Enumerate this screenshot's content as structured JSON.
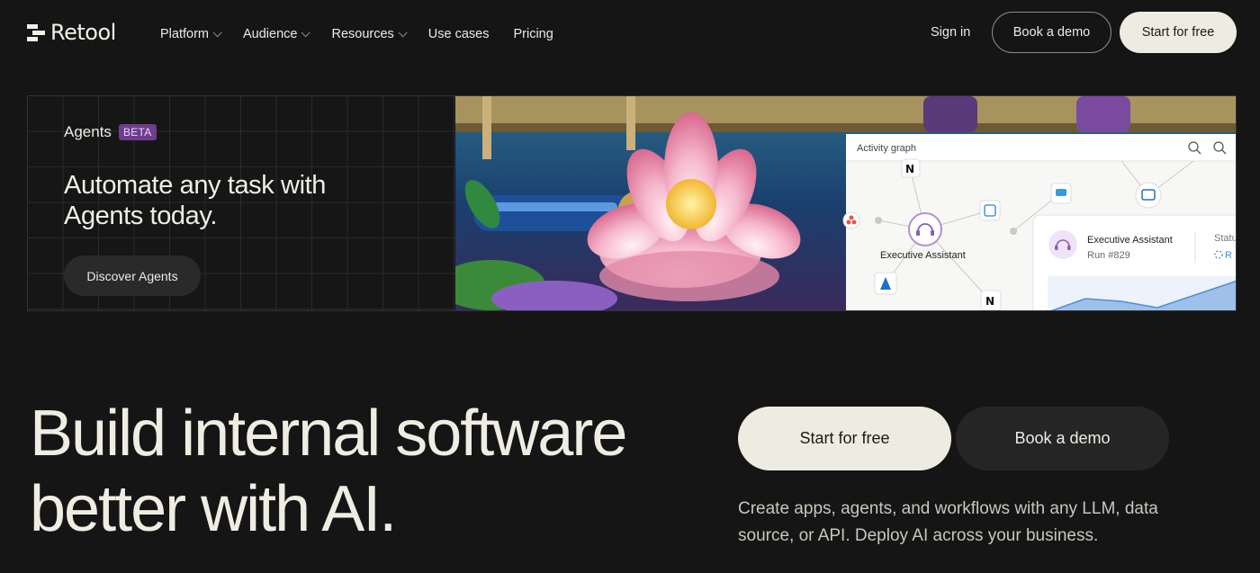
{
  "brand": {
    "name": "Retool"
  },
  "nav": {
    "items": [
      {
        "label": "Platform",
        "dropdown": true
      },
      {
        "label": "Audience",
        "dropdown": true
      },
      {
        "label": "Resources",
        "dropdown": true
      },
      {
        "label": "Use cases",
        "dropdown": false
      },
      {
        "label": "Pricing",
        "dropdown": false
      }
    ],
    "sign_in": "Sign in",
    "book_demo": "Book a demo",
    "start_free": "Start for free"
  },
  "banner": {
    "label": "Agents",
    "badge": "BETA",
    "title": "Automate any task with Agents today.",
    "cta": "Discover Agents",
    "activity_graph": {
      "title": "Activity graph",
      "node_label": "Executive Assistant",
      "card_title": "Executive Assistant",
      "card_run": "Run #829",
      "card_status": "Statu",
      "card_status_value": "R"
    }
  },
  "hero": {
    "title": "Build internal software better with AI.",
    "start_free": "Start for free",
    "book_demo": "Book a demo",
    "description": "Create apps, agents, and workflows with any LLM, data source, or API. Deploy AI across your business."
  },
  "colors": {
    "background": "#151515",
    "light_button": "#eeece0",
    "beta_badge": "#6e3d8e"
  }
}
